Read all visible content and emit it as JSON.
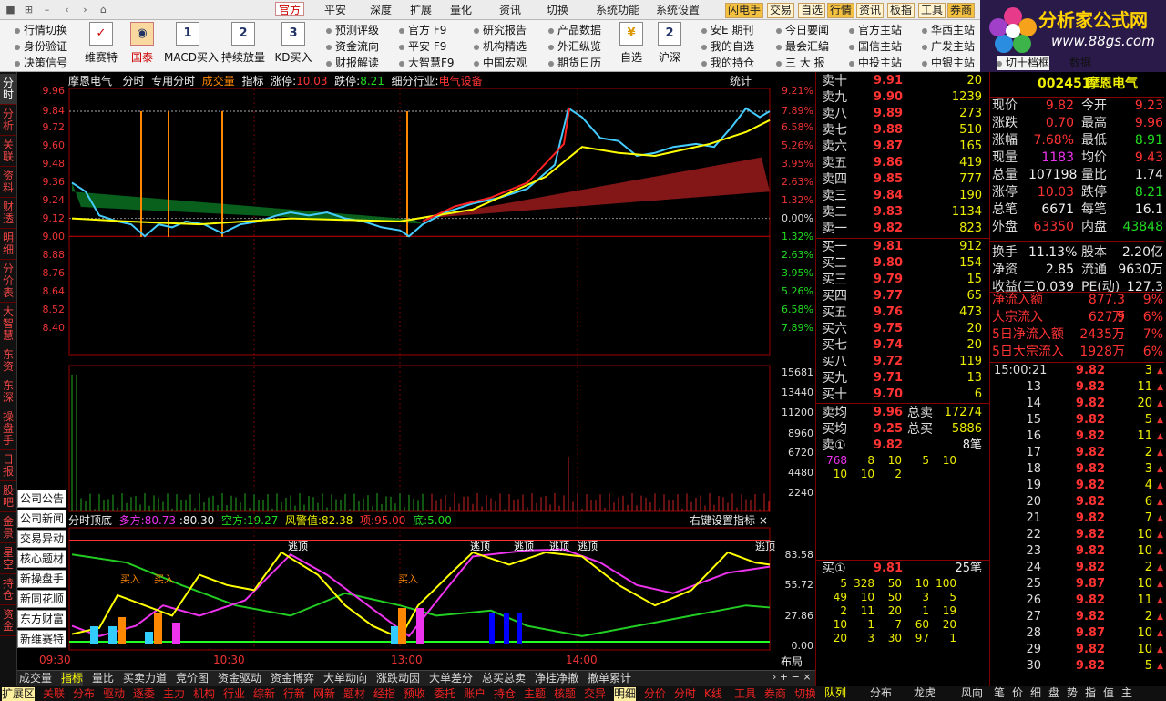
{
  "menu": {
    "items": [
      "官方",
      "平安",
      "深度",
      "扩展",
      "量化",
      "资讯",
      "切换",
      "系统功能",
      "系统设置"
    ],
    "quick": [
      "闪电手",
      "交易",
      "自选",
      "行情",
      "资讯",
      "板指",
      "工具",
      "券商"
    ]
  },
  "logo": {
    "brand": "分析家公式网",
    "url": "www.88gs.com"
  },
  "toolbar": {
    "left_links": [
      "行情切换",
      "身份验证",
      "决策信号"
    ],
    "big_buttons": [
      "维赛特",
      "国泰",
      "MACD买入",
      "持续放量",
      "KD买入",
      "自选",
      "沪深"
    ],
    "big_icons": [
      "✓",
      "◉",
      "1",
      "2",
      "3",
      "¥",
      "2"
    ],
    "mid_links": [
      [
        "预测评级",
        "资金流向",
        "财报解读"
      ],
      [
        "官方 F9",
        "平安 F9",
        "大智慧F9"
      ],
      [
        "研究报告",
        "机构精选",
        "中国宏观"
      ],
      [
        "产品数据",
        "外汇纵览",
        "期货日历"
      ],
      [
        "安E 期刊",
        "我的自选",
        "我的持仓"
      ],
      [
        "今日要闻",
        "最会汇编",
        "三 大 报"
      ],
      [
        "官方主站",
        "国信主站",
        "中投主站"
      ],
      [
        "华西主站",
        "广发主站",
        "中银主站"
      ]
    ],
    "extra_links": [
      "切十档框",
      "数据"
    ]
  },
  "leftnav": [
    "分时",
    "分析",
    "关联",
    "资料",
    "财透",
    "明细",
    "分价表",
    "大智慧",
    "东资",
    "东深",
    "操盘手",
    "日报",
    "股吧",
    "金景",
    "星空",
    "持仓",
    "资金"
  ],
  "chart": {
    "stock_name": "摩恩电气",
    "mode": "分时",
    "tab_special": "专用分时",
    "tab_volume": "成交量",
    "tab_indicator": "指标",
    "limit_up_label": "涨停:",
    "limit_up": "10.03",
    "limit_down_label": "跌停:",
    "limit_down": "8.21",
    "industry_label": "细分行业:",
    "industry": "电气设备",
    "stats_label": "统计",
    "price_axis": [
      "9.96",
      "9.84",
      "9.72",
      "9.60",
      "9.48",
      "9.36",
      "9.24",
      "9.12",
      "9.00",
      "8.88",
      "8.76",
      "8.64",
      "8.52",
      "8.40"
    ],
    "pct_axis": [
      "9.21%",
      "7.89%",
      "6.58%",
      "5.26%",
      "3.95%",
      "2.63%",
      "1.32%",
      "0.00%",
      "1.32%",
      "2.63%",
      "3.95%",
      "5.26%",
      "6.58%",
      "7.89%"
    ],
    "vol_axis": [
      "15681",
      "13440",
      "11200",
      "8960",
      "6720",
      "4480",
      "2240"
    ],
    "osc_axis": [
      "83.58",
      "55.72",
      "27.86",
      "0.00"
    ],
    "time_axis": [
      "09:30",
      "10:30",
      "13:00",
      "14:00"
    ],
    "layout_label": "布局"
  },
  "oscillator": {
    "title": "分时顶底",
    "k1_label": "多方:",
    "k1": "80.73",
    "k2": ":80.30",
    "k3_label": "空方:",
    "k3": "19.27",
    "k4_label": "风警值:",
    "k4": "82.38",
    "k5_label": "项:",
    "k5": "95.00",
    "k6_label": "底:",
    "k6": "5.00",
    "settings": "右键设置指标",
    "buy_label": "买入",
    "escape_label": "逃顶"
  },
  "leftboxes": [
    "公司公告",
    "公司新闻",
    "交易异动",
    "核心题材",
    "新操盘手",
    "新同花顺",
    "东方财富",
    "新维赛特"
  ],
  "bottomtabs": [
    "成交量",
    "指标",
    "量比",
    "买卖力道",
    "竞价图",
    "资金驱动",
    "资金博弈",
    "大单动向",
    "涨跌动因",
    "大单差分",
    "总买总卖",
    "净挂净撤",
    "撤单累计"
  ],
  "statusbar": [
    "扩展区",
    "关联",
    "分布",
    "驱动",
    "逐委",
    "主力",
    "机构",
    "行业",
    "综新",
    "行新",
    "网新",
    "题材",
    "经指",
    "预收",
    "委托",
    "账户",
    "持仓",
    "主题",
    "核题",
    "交异",
    "明细",
    "分价",
    "分时",
    "K线",
    "工具",
    "券商",
    "切换"
  ],
  "orderbook": {
    "asks": [
      {
        "label": "卖十",
        "price": "9.91",
        "vol": "20"
      },
      {
        "label": "卖九",
        "price": "9.90",
        "vol": "1239"
      },
      {
        "label": "卖八",
        "price": "9.89",
        "vol": "273"
      },
      {
        "label": "卖七",
        "price": "9.88",
        "vol": "510"
      },
      {
        "label": "卖六",
        "price": "9.87",
        "vol": "165"
      },
      {
        "label": "卖五",
        "price": "9.86",
        "vol": "419"
      },
      {
        "label": "卖四",
        "price": "9.85",
        "vol": "777"
      },
      {
        "label": "卖三",
        "price": "9.84",
        "vol": "190"
      },
      {
        "label": "卖二",
        "price": "9.83",
        "vol": "1134"
      },
      {
        "label": "卖一",
        "price": "9.82",
        "vol": "823"
      }
    ],
    "bids": [
      {
        "label": "买一",
        "price": "9.81",
        "vol": "912"
      },
      {
        "label": "买二",
        "price": "9.80",
        "vol": "154"
      },
      {
        "label": "买三",
        "price": "9.79",
        "vol": "15"
      },
      {
        "label": "买四",
        "price": "9.77",
        "vol": "65"
      },
      {
        "label": "买五",
        "price": "9.76",
        "vol": "473"
      },
      {
        "label": "买六",
        "price": "9.75",
        "vol": "20"
      },
      {
        "label": "买七",
        "price": "9.74",
        "vol": "20"
      },
      {
        "label": "买八",
        "price": "9.72",
        "vol": "119"
      },
      {
        "label": "买九",
        "price": "9.71",
        "vol": "13"
      },
      {
        "label": "买十",
        "price": "9.70",
        "vol": "6"
      }
    ],
    "ask_avg_label": "卖均",
    "ask_avg": "9.96",
    "ask_total_label": "总卖",
    "ask_total": "17274",
    "bid_avg_label": "买均",
    "bid_avg": "9.25",
    "bid_total_label": "总买",
    "bid_total": "5886",
    "ask1_label": "卖①",
    "ask1_price": "9.82",
    "ask1_count": "8笔",
    "ask1_orders": [
      "768",
      "8",
      "10",
      "5",
      "10",
      "10",
      "10",
      "2"
    ],
    "bid1_label": "买①",
    "bid1_price": "9.81",
    "bid1_count": "25笔",
    "bid1_orders": [
      "5",
      "328",
      "50",
      "10",
      "100",
      "49",
      "10",
      "50",
      "3",
      "5",
      "2",
      "11",
      "20",
      "1",
      "19",
      "10",
      "1",
      "7",
      "60",
      "20",
      "20",
      "3",
      "30",
      "97",
      "1"
    ]
  },
  "quote": {
    "code": "002451",
    "name": "摩恩电气",
    "rows": [
      [
        "现价",
        "9.82",
        "今开",
        "9.23"
      ],
      [
        "涨跌",
        "0.70",
        "最高",
        "9.96"
      ],
      [
        "涨幅",
        "7.68%",
        "最低",
        "8.91"
      ],
      [
        "现量",
        "1183",
        "均价",
        "9.43"
      ],
      [
        "总量",
        "107198",
        "量比",
        "1.74"
      ],
      [
        "涨停",
        "10.03",
        "跌停",
        "8.21"
      ],
      [
        "总笔",
        "6671",
        "每笔",
        "16.1"
      ],
      [
        "外盘",
        "63350",
        "内盘",
        "43848"
      ],
      [
        "换手",
        "11.13%",
        "股本",
        "2.20亿"
      ],
      [
        "净资",
        "2.85",
        "流通",
        "9630万"
      ],
      [
        "收益(三)",
        "0.039",
        "PE(动)",
        "127.3"
      ]
    ],
    "flows": [
      [
        "净流入额",
        "877.3万",
        "9%"
      ],
      [
        "大宗流入",
        "627.9万",
        "6%"
      ],
      [
        "5日净流入额",
        "2435万",
        "7%"
      ],
      [
        "5日大宗流入",
        "1928万",
        "6%"
      ]
    ],
    "ticks": [
      {
        "t": "15:00:21",
        "p": "9.82",
        "v": "3"
      },
      {
        "t": "13",
        "p": "9.82",
        "v": "11"
      },
      {
        "t": "14",
        "p": "9.82",
        "v": "20"
      },
      {
        "t": "15",
        "p": "9.82",
        "v": "5"
      },
      {
        "t": "16",
        "p": "9.82",
        "v": "11"
      },
      {
        "t": "17",
        "p": "9.82",
        "v": "2"
      },
      {
        "t": "18",
        "p": "9.82",
        "v": "3"
      },
      {
        "t": "19",
        "p": "9.82",
        "v": "4"
      },
      {
        "t": "20",
        "p": "9.82",
        "v": "6"
      },
      {
        "t": "21",
        "p": "9.82",
        "v": "7"
      },
      {
        "t": "22",
        "p": "9.82",
        "v": "10"
      },
      {
        "t": "23",
        "p": "9.82",
        "v": "10"
      },
      {
        "t": "24",
        "p": "9.82",
        "v": "2"
      },
      {
        "t": "25",
        "p": "9.87",
        "v": "10"
      },
      {
        "t": "26",
        "p": "9.82",
        "v": "11"
      },
      {
        "t": "27",
        "p": "9.82",
        "v": "2"
      },
      {
        "t": "28",
        "p": "9.87",
        "v": "10"
      },
      {
        "t": "29",
        "p": "9.82",
        "v": "10"
      },
      {
        "t": "30",
        "p": "9.82",
        "v": "5"
      }
    ]
  },
  "rbottom": [
    "队列",
    "分布",
    "龙虎",
    "风向",
    "笔",
    "价",
    "细",
    "盘",
    "势",
    "指",
    "值",
    "主"
  ],
  "colors": {
    "up": "#ff3333",
    "down": "#22dd22",
    "vol": "#eeee00",
    "accent": "#cc0000"
  }
}
